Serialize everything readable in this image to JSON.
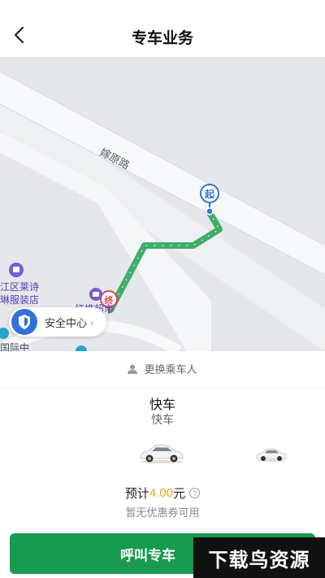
{
  "header": {
    "title": "专车业务"
  },
  "map": {
    "road_label": "嫁原路",
    "poi_store_line1": "江区莱诗",
    "poi_store_line2": "琳服装店",
    "poi_bottom_label": "红堆超市",
    "poi_left_partial": "国际中",
    "start_marker": "起",
    "end_marker": "终",
    "route_color": "#3fae6a"
  },
  "safety": {
    "label": "安全中心",
    "icon": "shield-icon"
  },
  "sheet": {
    "change_rider": "更换乘车人",
    "car_name": "快车",
    "car_subtitle": "快车",
    "price_prefix": "预计",
    "price_value": "4.00",
    "price_unit": "元",
    "coupon_text": "暂无优惠券可用",
    "call_button": "呼叫专车"
  },
  "colors": {
    "primary": "#169a4f",
    "price": "#f2a51a",
    "status_accent": "#1fb26a"
  },
  "watermark": {
    "text": "下载鸟资源"
  }
}
